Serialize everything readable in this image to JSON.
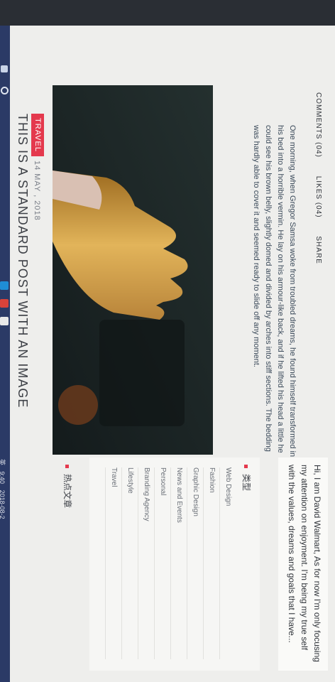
{
  "post": {
    "category": "TRAVEL",
    "date": "14 MAY , 2018",
    "title": "THIS IS A STANDARD POST WITH AN IMAGE",
    "excerpt": "One morning, when Gregor Samsa woke from troubled dreams, he found himself transformed in his bed into a horrible vermin. He lay on his armour-like back, and if he lifted his head a little he could see his brown belly, slightly domed and divided by arches into stiff sections. The bedding was hardly able to cover it and seemed ready to slide off any moment.",
    "actions": {
      "comments": "COMMENTS (04)",
      "likes": "LIKES (04)",
      "share": "SHARE"
    }
  },
  "sidebar": {
    "about": "Hi, I am David Walmart, As for now I'm only focusing my attention on enjoyment. I'm being my true self with the values, dreams and goals that I have...",
    "categories_title": "类型",
    "categories": [
      "Web Design",
      "Fashion",
      "Graphic Design",
      "News and Events",
      "Personal",
      "Branding Agency",
      "Lifestyle",
      "Travel"
    ],
    "hot_title": "热点文章"
  },
  "taskbar": {
    "time": "9:40",
    "date": "2018-08-2",
    "ime": "英"
  },
  "colors": {
    "accent": "#e4394d",
    "background": "#eeeeec"
  }
}
